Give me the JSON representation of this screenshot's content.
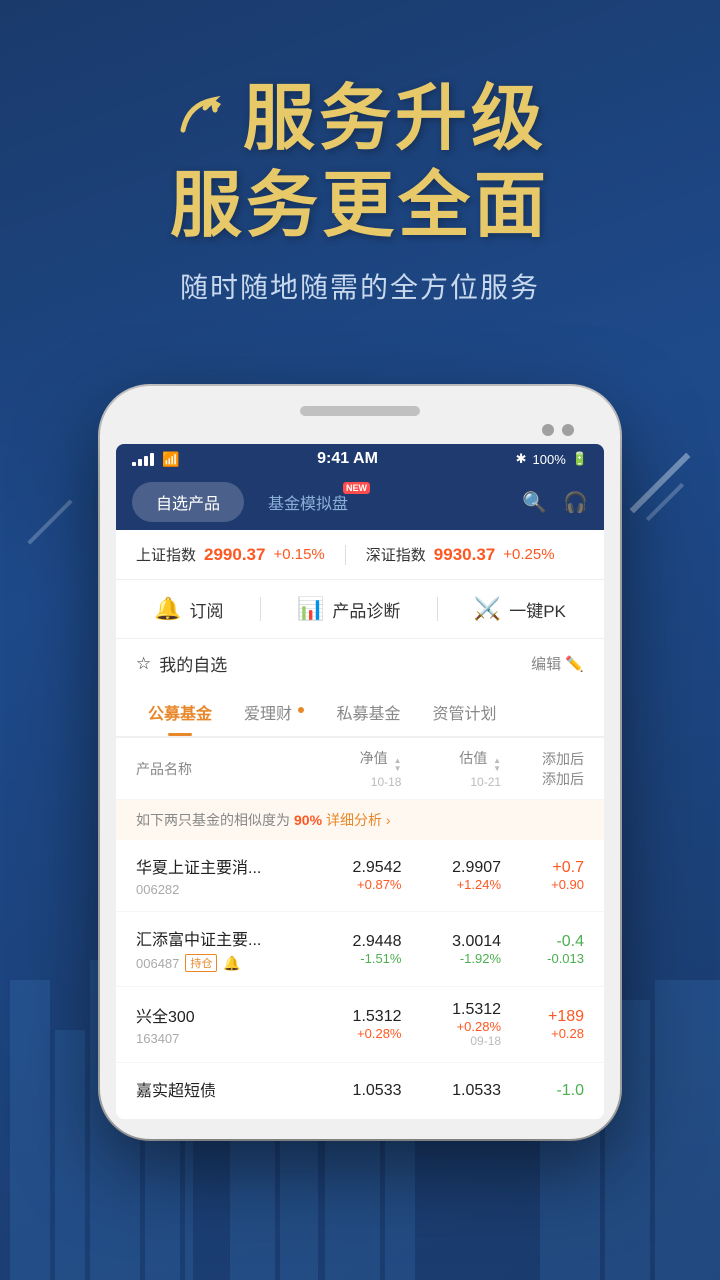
{
  "hero": {
    "line1": "服务升级",
    "line2": "服务更全面",
    "subtitle": "随时随地随需的全方位服务",
    "arrow_icon": "↗"
  },
  "status_bar": {
    "time": "9:41 AM",
    "battery": "100%",
    "bluetooth": "✱"
  },
  "nav": {
    "tab1": "自选产品",
    "tab2": "基金模拟盘",
    "tab2_badge": "NEW"
  },
  "ticker": {
    "shanghai_label": "上证指数",
    "shanghai_value": "2990.37",
    "shanghai_change": "+0.15%",
    "shenzhen_label": "深证指数",
    "shenzhen_value": "9930.37",
    "shenzhen_change": "+0.25%"
  },
  "tools": {
    "subscribe": "订阅",
    "diagnose": "产品诊断",
    "pk": "一键PK"
  },
  "watchlist": {
    "title": "我的自选",
    "edit": "编辑"
  },
  "categories": {
    "tab1": "公募基金",
    "tab2": "爱理财",
    "tab3": "私募基金",
    "tab4": "资管计划"
  },
  "table_header": {
    "col1": "产品名称",
    "col2": "净值",
    "col2_date": "10-18",
    "col3": "估值",
    "col3_date": "10-21",
    "col4": "添加后",
    "col4b": "添加后"
  },
  "similarity_banner": {
    "text1": "如下两只基金的相似度为",
    "pct": "90%",
    "link": "详细分析 ›"
  },
  "funds": [
    {
      "name": "华夏上证主要消...",
      "code": "006282",
      "nav_value": "2.9542",
      "nav_change": "+0.87%",
      "nav_change_dir": "up",
      "est_value": "2.9907",
      "est_change": "+1.24%",
      "est_change_dir": "up",
      "add_value": "+0.7",
      "add_change": "+0.90",
      "add_dir": "up",
      "tag": "",
      "bell": false
    },
    {
      "name": "汇添富中证主要...",
      "code": "006487",
      "nav_value": "2.9448",
      "nav_change": "-1.51%",
      "nav_change_dir": "down",
      "est_value": "3.0014",
      "est_change": "-1.92%",
      "est_change_dir": "down",
      "add_value": "-0.4",
      "add_change": "-0.013",
      "add_dir": "down",
      "tag": "持仓",
      "bell": true
    },
    {
      "name": "兴全300",
      "code": "163407",
      "nav_value": "1.5312",
      "nav_change": "+0.28%",
      "nav_change_dir": "up",
      "est_value": "1.5312",
      "est_change": "+0.28%",
      "est_change_dir": "up",
      "add_value": "+189",
      "add_change": "+0.28",
      "add_dir": "up",
      "extra_date": "09-18",
      "tag": "",
      "bell": false
    },
    {
      "name": "嘉实超短债",
      "code": "",
      "nav_value": "1.0533",
      "nav_change": "",
      "nav_change_dir": "up",
      "est_value": "1.0533",
      "est_change": "",
      "est_change_dir": "up",
      "add_value": "-1.0",
      "add_change": "",
      "add_dir": "down",
      "tag": "",
      "bell": false
    }
  ]
}
